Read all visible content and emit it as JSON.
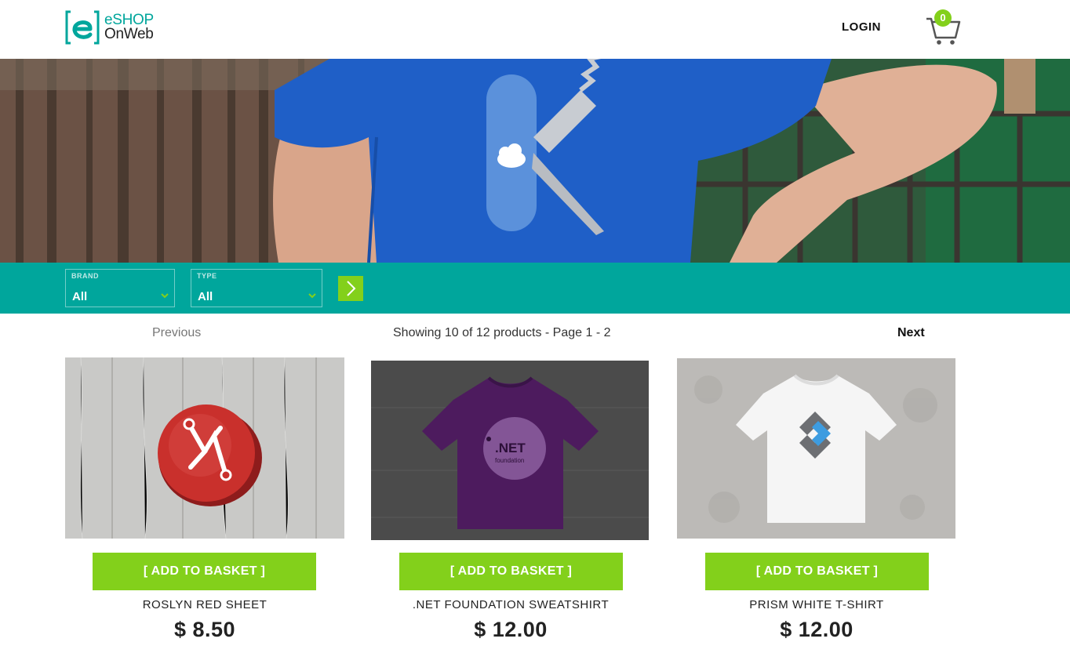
{
  "header": {
    "logo_line1": "eSHOP",
    "logo_line2": "OnWeb",
    "login_label": "LOGIN",
    "cart_count": "0"
  },
  "filters": {
    "brand": {
      "label": "BRAND",
      "value": "All"
    },
    "type": {
      "label": "TYPE",
      "value": "All"
    }
  },
  "pager": {
    "previous": "Previous",
    "info": "Showing 10 of 12 products - Page 1 - 2",
    "next": "Next"
  },
  "products": [
    {
      "name": "ROSLYN RED SHEET",
      "price": "$ 8.50",
      "button": "[ ADD TO BASKET ]"
    },
    {
      "name": ".NET FOUNDATION SWEATSHIRT",
      "price": "$ 12.00",
      "button": "[ ADD TO BASKET ]"
    },
    {
      "name": "PRISM WHITE T-SHIRT",
      "price": "$ 12.00",
      "button": "[ ADD TO BASKET ]"
    }
  ],
  "colors": {
    "brand_teal": "#00a69c",
    "accent_green": "#83d01b"
  }
}
